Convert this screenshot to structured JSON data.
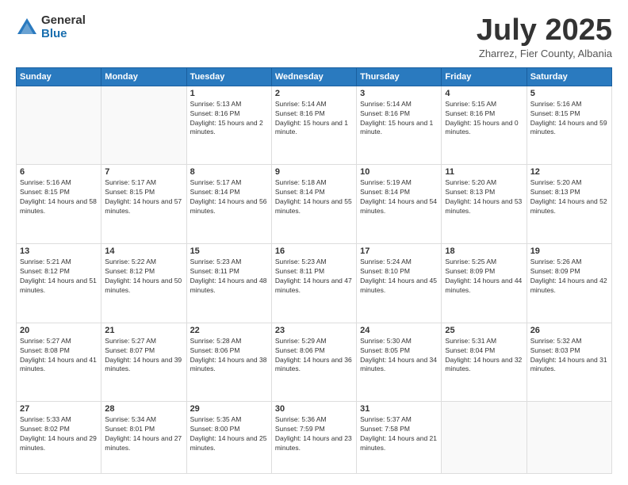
{
  "logo": {
    "general": "General",
    "blue": "Blue"
  },
  "title": "July 2025",
  "subtitle": "Zharrez, Fier County, Albania",
  "headers": [
    "Sunday",
    "Monday",
    "Tuesday",
    "Wednesday",
    "Thursday",
    "Friday",
    "Saturday"
  ],
  "weeks": [
    [
      {
        "num": "",
        "info": ""
      },
      {
        "num": "",
        "info": ""
      },
      {
        "num": "1",
        "info": "Sunrise: 5:13 AM\nSunset: 8:16 PM\nDaylight: 15 hours and 2 minutes."
      },
      {
        "num": "2",
        "info": "Sunrise: 5:14 AM\nSunset: 8:16 PM\nDaylight: 15 hours and 1 minute."
      },
      {
        "num": "3",
        "info": "Sunrise: 5:14 AM\nSunset: 8:16 PM\nDaylight: 15 hours and 1 minute."
      },
      {
        "num": "4",
        "info": "Sunrise: 5:15 AM\nSunset: 8:16 PM\nDaylight: 15 hours and 0 minutes."
      },
      {
        "num": "5",
        "info": "Sunrise: 5:16 AM\nSunset: 8:15 PM\nDaylight: 14 hours and 59 minutes."
      }
    ],
    [
      {
        "num": "6",
        "info": "Sunrise: 5:16 AM\nSunset: 8:15 PM\nDaylight: 14 hours and 58 minutes."
      },
      {
        "num": "7",
        "info": "Sunrise: 5:17 AM\nSunset: 8:15 PM\nDaylight: 14 hours and 57 minutes."
      },
      {
        "num": "8",
        "info": "Sunrise: 5:17 AM\nSunset: 8:14 PM\nDaylight: 14 hours and 56 minutes."
      },
      {
        "num": "9",
        "info": "Sunrise: 5:18 AM\nSunset: 8:14 PM\nDaylight: 14 hours and 55 minutes."
      },
      {
        "num": "10",
        "info": "Sunrise: 5:19 AM\nSunset: 8:14 PM\nDaylight: 14 hours and 54 minutes."
      },
      {
        "num": "11",
        "info": "Sunrise: 5:20 AM\nSunset: 8:13 PM\nDaylight: 14 hours and 53 minutes."
      },
      {
        "num": "12",
        "info": "Sunrise: 5:20 AM\nSunset: 8:13 PM\nDaylight: 14 hours and 52 minutes."
      }
    ],
    [
      {
        "num": "13",
        "info": "Sunrise: 5:21 AM\nSunset: 8:12 PM\nDaylight: 14 hours and 51 minutes."
      },
      {
        "num": "14",
        "info": "Sunrise: 5:22 AM\nSunset: 8:12 PM\nDaylight: 14 hours and 50 minutes."
      },
      {
        "num": "15",
        "info": "Sunrise: 5:23 AM\nSunset: 8:11 PM\nDaylight: 14 hours and 48 minutes."
      },
      {
        "num": "16",
        "info": "Sunrise: 5:23 AM\nSunset: 8:11 PM\nDaylight: 14 hours and 47 minutes."
      },
      {
        "num": "17",
        "info": "Sunrise: 5:24 AM\nSunset: 8:10 PM\nDaylight: 14 hours and 45 minutes."
      },
      {
        "num": "18",
        "info": "Sunrise: 5:25 AM\nSunset: 8:09 PM\nDaylight: 14 hours and 44 minutes."
      },
      {
        "num": "19",
        "info": "Sunrise: 5:26 AM\nSunset: 8:09 PM\nDaylight: 14 hours and 42 minutes."
      }
    ],
    [
      {
        "num": "20",
        "info": "Sunrise: 5:27 AM\nSunset: 8:08 PM\nDaylight: 14 hours and 41 minutes."
      },
      {
        "num": "21",
        "info": "Sunrise: 5:27 AM\nSunset: 8:07 PM\nDaylight: 14 hours and 39 minutes."
      },
      {
        "num": "22",
        "info": "Sunrise: 5:28 AM\nSunset: 8:06 PM\nDaylight: 14 hours and 38 minutes."
      },
      {
        "num": "23",
        "info": "Sunrise: 5:29 AM\nSunset: 8:06 PM\nDaylight: 14 hours and 36 minutes."
      },
      {
        "num": "24",
        "info": "Sunrise: 5:30 AM\nSunset: 8:05 PM\nDaylight: 14 hours and 34 minutes."
      },
      {
        "num": "25",
        "info": "Sunrise: 5:31 AM\nSunset: 8:04 PM\nDaylight: 14 hours and 32 minutes."
      },
      {
        "num": "26",
        "info": "Sunrise: 5:32 AM\nSunset: 8:03 PM\nDaylight: 14 hours and 31 minutes."
      }
    ],
    [
      {
        "num": "27",
        "info": "Sunrise: 5:33 AM\nSunset: 8:02 PM\nDaylight: 14 hours and 29 minutes."
      },
      {
        "num": "28",
        "info": "Sunrise: 5:34 AM\nSunset: 8:01 PM\nDaylight: 14 hours and 27 minutes."
      },
      {
        "num": "29",
        "info": "Sunrise: 5:35 AM\nSunset: 8:00 PM\nDaylight: 14 hours and 25 minutes."
      },
      {
        "num": "30",
        "info": "Sunrise: 5:36 AM\nSunset: 7:59 PM\nDaylight: 14 hours and 23 minutes."
      },
      {
        "num": "31",
        "info": "Sunrise: 5:37 AM\nSunset: 7:58 PM\nDaylight: 14 hours and 21 minutes."
      },
      {
        "num": "",
        "info": ""
      },
      {
        "num": "",
        "info": ""
      }
    ]
  ]
}
